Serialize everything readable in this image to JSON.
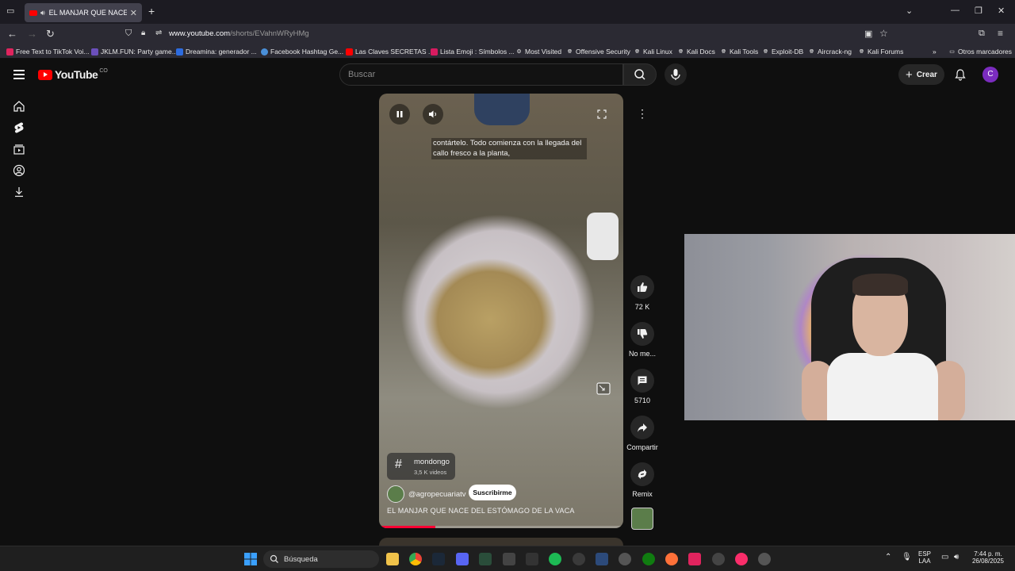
{
  "browser": {
    "tab_title": "EL MANJAR QUE NACE DEL",
    "url_host": "www.youtube.com",
    "url_path": "/shorts/EVahnWRyHMg",
    "bookmarks": [
      "Free Text to TikTok Voi...",
      "JKLM.FUN: Party game...",
      "Dreamina: generador ...",
      "Facebook Hashtag Ge...",
      "Las Claves SECRETAS ...",
      "Lista Emoji : Símbolos ...",
      "Most Visited",
      "Offensive Security",
      "Kali Linux",
      "Kali Docs",
      "Kali Tools",
      "Exploit-DB",
      "Aircrack-ng",
      "Kali Forums"
    ],
    "other_bookmarks": "Otros marcadores"
  },
  "youtube": {
    "logo_text": "YouTube",
    "country_code": "CO",
    "search_placeholder": "Buscar",
    "create_label": "Crear",
    "avatar_letter": "C"
  },
  "short": {
    "caption": "contártelo. Todo comienza con la llegada del callo fresco a la planta,",
    "hashtag": "mondongo",
    "hashtag_count": "3,5 K videos",
    "channel": "@agropecuariatv",
    "subscribe_label": "Suscribirme",
    "title": "EL MANJAR QUE NACE DEL ESTÓMAGO DE LA VACA",
    "progress": 0.23,
    "likes": "72 K",
    "dislike_label": "No me...",
    "comments": "5710",
    "share_label": "Compartir",
    "remix_label": "Remix"
  },
  "taskbar": {
    "search_label": "Búsqueda",
    "lang_1": "ESP",
    "lang_2": "LAA",
    "time": "7:44 p. m.",
    "date": "26/08/2025"
  },
  "colors": {
    "accent_red": "#ff0000",
    "avatar": "#7b2cbf",
    "background": "#0f0f0f"
  }
}
